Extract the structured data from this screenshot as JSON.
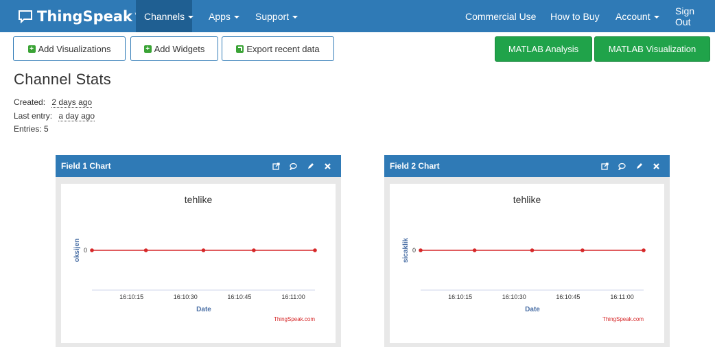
{
  "nav": {
    "brand": "ThingSpeak",
    "brand_tm": "™",
    "channels": "Channels",
    "apps": "Apps",
    "support": "Support",
    "commercial": "Commercial Use",
    "how_to_buy": "How to Buy",
    "account": "Account",
    "sign_out": "Sign Out"
  },
  "toolbar": {
    "add_visualizations": "Add Visualizations",
    "add_widgets": "Add Widgets",
    "export": "Export recent data",
    "matlab_analysis": "MATLAB Analysis",
    "matlab_visualization": "MATLAB Visualization"
  },
  "stats": {
    "title": "Channel Stats",
    "created_label": "Created:",
    "created_value": "2 days ago",
    "last_entry_label": "Last entry:",
    "last_entry_value": "a day ago",
    "entries_label": "Entries:",
    "entries_value": "5"
  },
  "colors": {
    "nav_bg": "#2f7ab6",
    "accent_green": "#20a34a",
    "series_red": "#d62728"
  },
  "charts": [
    {
      "card_title": "Field 1 Chart",
      "credit": "ThingSpeak.com"
    },
    {
      "card_title": "Field 2 Chart",
      "credit": "ThingSpeak.com"
    }
  ],
  "chart_data": [
    {
      "type": "line",
      "title": "tehlike",
      "xlabel": "Date",
      "ylabel": "oksijen",
      "x": [
        "16:10:04",
        "16:10:19",
        "16:10:35",
        "16:10:49",
        "16:11:06"
      ],
      "x_ticks": [
        "16:10:15",
        "16:10:30",
        "16:10:45",
        "16:11:00"
      ],
      "y_ticks": [
        "0"
      ],
      "series": [
        {
          "values": [
            0,
            0,
            0,
            0,
            0
          ]
        }
      ],
      "grid": false,
      "legend": "none"
    },
    {
      "type": "line",
      "title": "tehlike",
      "xlabel": "Date",
      "ylabel": "sicaklik",
      "x": [
        "16:10:04",
        "16:10:19",
        "16:10:35",
        "16:10:49",
        "16:11:06"
      ],
      "x_ticks": [
        "16:10:15",
        "16:10:30",
        "16:10:45",
        "16:11:00"
      ],
      "y_ticks": [
        "0"
      ],
      "series": [
        {
          "values": [
            0,
            0,
            0,
            0,
            0
          ]
        }
      ],
      "grid": false,
      "legend": "none"
    }
  ]
}
